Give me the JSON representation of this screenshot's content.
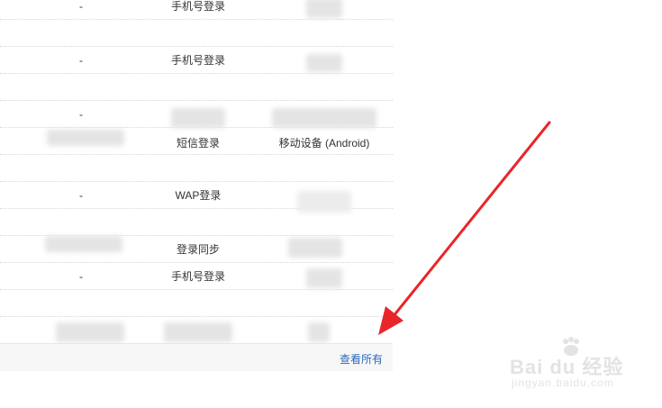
{
  "login_records": {
    "rows": [
      {
        "col1": "-",
        "col2": "手机号登录",
        "col3": ""
      },
      {
        "col1": "",
        "col2": "",
        "col3": ""
      },
      {
        "col1": "-",
        "col2": "手机号登录",
        "col3": ""
      },
      {
        "col1": "",
        "col2": "",
        "col3": ""
      },
      {
        "col1": "-",
        "col2": "",
        "col3": ""
      },
      {
        "col1": "",
        "col2": "短信登录",
        "col3": "移动设备 (Android)"
      },
      {
        "col1": "",
        "col2": "",
        "col3": ""
      },
      {
        "col1": "-",
        "col2": "WAP登录",
        "col3": ""
      },
      {
        "col1": "",
        "col2": "",
        "col3": ""
      },
      {
        "col1": "",
        "col2": "登录同步",
        "col3": ""
      },
      {
        "col1": "-",
        "col2": "手机号登录",
        "col3": ""
      },
      {
        "col1": "",
        "col2": "",
        "col3": ""
      },
      {
        "col1": "",
        "col2": "",
        "col3": ""
      }
    ],
    "view_all_label": "查看所有"
  },
  "watermark": {
    "logo_text": "Bai du 经验",
    "site_text": "jingyan.baidu.com"
  },
  "colors": {
    "link": "#2a6bbd",
    "arrow": "#e8262a",
    "divider": "#d6d6d6"
  }
}
